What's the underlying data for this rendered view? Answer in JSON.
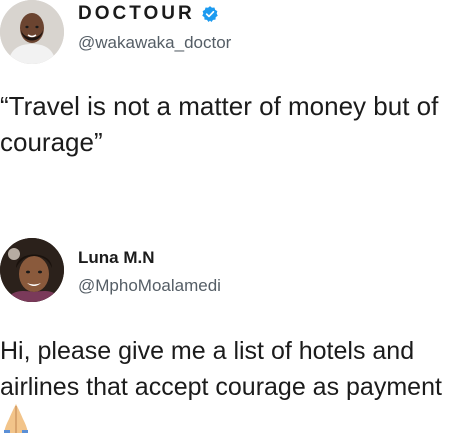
{
  "tweets": [
    {
      "author": {
        "display_name": "DOCTOUR",
        "handle": "@wakawaka_doctor",
        "verified": true,
        "avatar_icon": "avatar-man-icon"
      },
      "text_lines": [
        "“Travel is not a matter of money but of",
        "courage”"
      ]
    },
    {
      "author": {
        "display_name": "Luna M.N",
        "handle": "@MphoMoalamedi",
        "verified": false,
        "avatar_icon": "avatar-woman-icon"
      },
      "text_lines": [
        "Hi, please give me a list of hotels and",
        "airlines that accept courage as payment"
      ],
      "emoji": "praying-hands-icon"
    }
  ],
  "colors": {
    "text": "#1b1b1b",
    "handle": "#555e66",
    "verified": "#1d9bf0",
    "background": "#ffffff"
  }
}
